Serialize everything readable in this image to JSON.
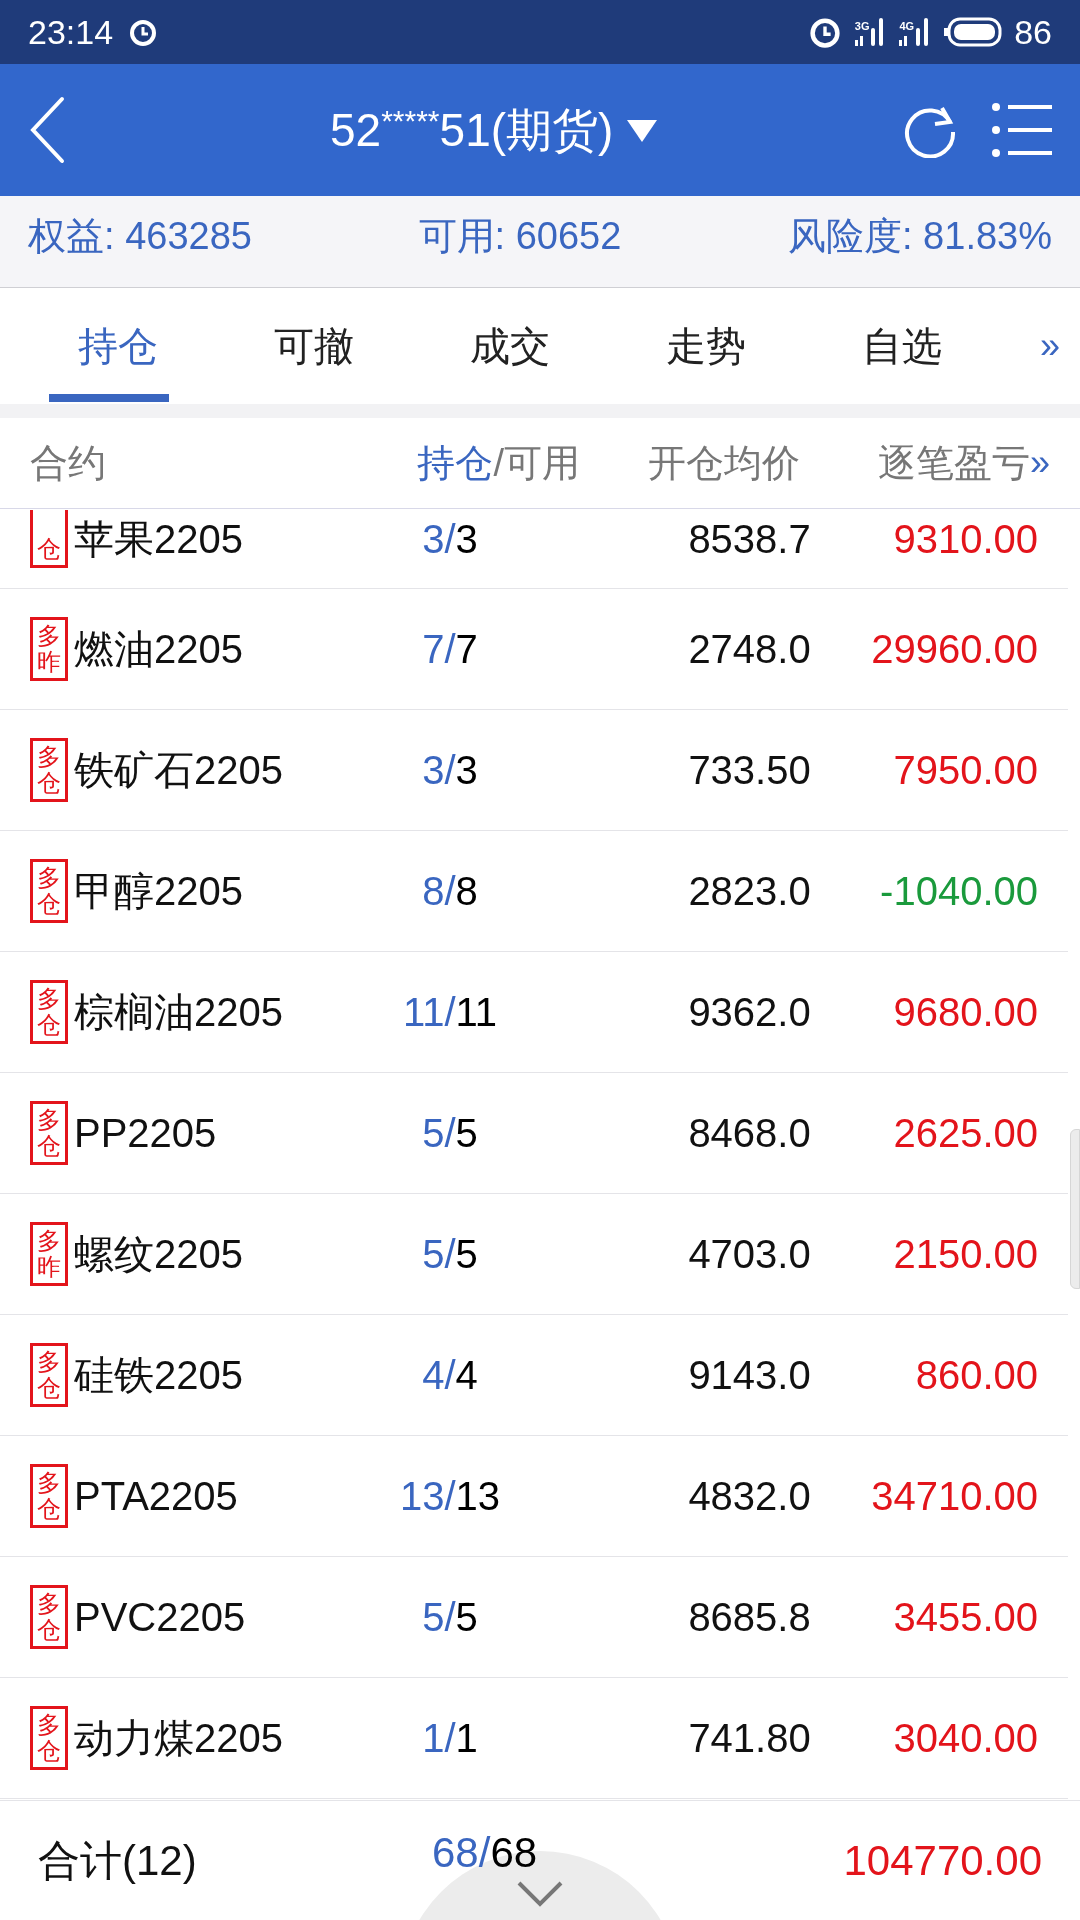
{
  "status_bar": {
    "time": "23:14",
    "network_1": "3G",
    "network_2": "4G",
    "battery": "86"
  },
  "header": {
    "account_prefix": "52",
    "account_mask": "*****",
    "account_suffix": "51(期货)"
  },
  "summary": [
    {
      "label": "权益:",
      "value": "463285"
    },
    {
      "label": "可用:",
      "value": "60652"
    },
    {
      "label": "风险度:",
      "value": "81.83%"
    }
  ],
  "tabs": [
    {
      "label": "持仓",
      "selected": true
    },
    {
      "label": "可撤",
      "selected": false
    },
    {
      "label": "成交",
      "selected": false
    },
    {
      "label": "走势",
      "selected": false
    },
    {
      "label": "自选",
      "selected": false
    }
  ],
  "tabs_more": "»",
  "columns": {
    "contract": "合约",
    "held": "持仓",
    "available": "/可用",
    "open_price": "开仓均价",
    "profit": "逐笔盈亏",
    "more": "»"
  },
  "separator": "/",
  "rows": [
    {
      "badge": "仓",
      "cut_top": true,
      "contract": "苹果2205",
      "held": "3",
      "available": "3",
      "open_price": "8538.7",
      "profit": "9310.00",
      "kind": "gain"
    },
    {
      "badge": "多昨",
      "cut_top": false,
      "contract": "燃油2205",
      "held": "7",
      "available": "7",
      "open_price": "2748.0",
      "profit": "29960.00",
      "kind": "gain"
    },
    {
      "badge": "多仓",
      "cut_top": false,
      "contract": "铁矿石2205",
      "held": "3",
      "available": "3",
      "open_price": "733.50",
      "profit": "7950.00",
      "kind": "gain"
    },
    {
      "badge": "多仓",
      "cut_top": false,
      "contract": "甲醇2205",
      "held": "8",
      "available": "8",
      "open_price": "2823.0",
      "profit": "-1040.00",
      "kind": "loss"
    },
    {
      "badge": "多仓",
      "cut_top": false,
      "contract": "棕榈油2205",
      "held": "11",
      "available": "11",
      "open_price": "9362.0",
      "profit": "9680.00",
      "kind": "gain"
    },
    {
      "badge": "多仓",
      "cut_top": false,
      "contract": "PP2205",
      "held": "5",
      "available": "5",
      "open_price": "8468.0",
      "profit": "2625.00",
      "kind": "gain"
    },
    {
      "badge": "多昨",
      "cut_top": false,
      "contract": "螺纹2205",
      "held": "5",
      "available": "5",
      "open_price": "4703.0",
      "profit": "2150.00",
      "kind": "gain"
    },
    {
      "badge": "多仓",
      "cut_top": false,
      "contract": "硅铁2205",
      "held": "4",
      "available": "4",
      "open_price": "9143.0",
      "profit": "860.00",
      "kind": "gain"
    },
    {
      "badge": "多仓",
      "cut_top": false,
      "contract": "PTA2205",
      "held": "13",
      "available": "13",
      "open_price": "4832.0",
      "profit": "34710.00",
      "kind": "gain"
    },
    {
      "badge": "多仓",
      "cut_top": false,
      "contract": "PVC2205",
      "held": "5",
      "available": "5",
      "open_price": "8685.8",
      "profit": "3455.00",
      "kind": "gain"
    },
    {
      "badge": "多仓",
      "cut_top": false,
      "contract": "动力煤2205",
      "held": "1",
      "available": "1",
      "open_price": "741.80",
      "profit": "3040.00",
      "kind": "gain"
    }
  ],
  "total": {
    "label": "合计(12)",
    "held": "68",
    "available": "68",
    "profit": "104770.00",
    "kind": "gain"
  }
}
